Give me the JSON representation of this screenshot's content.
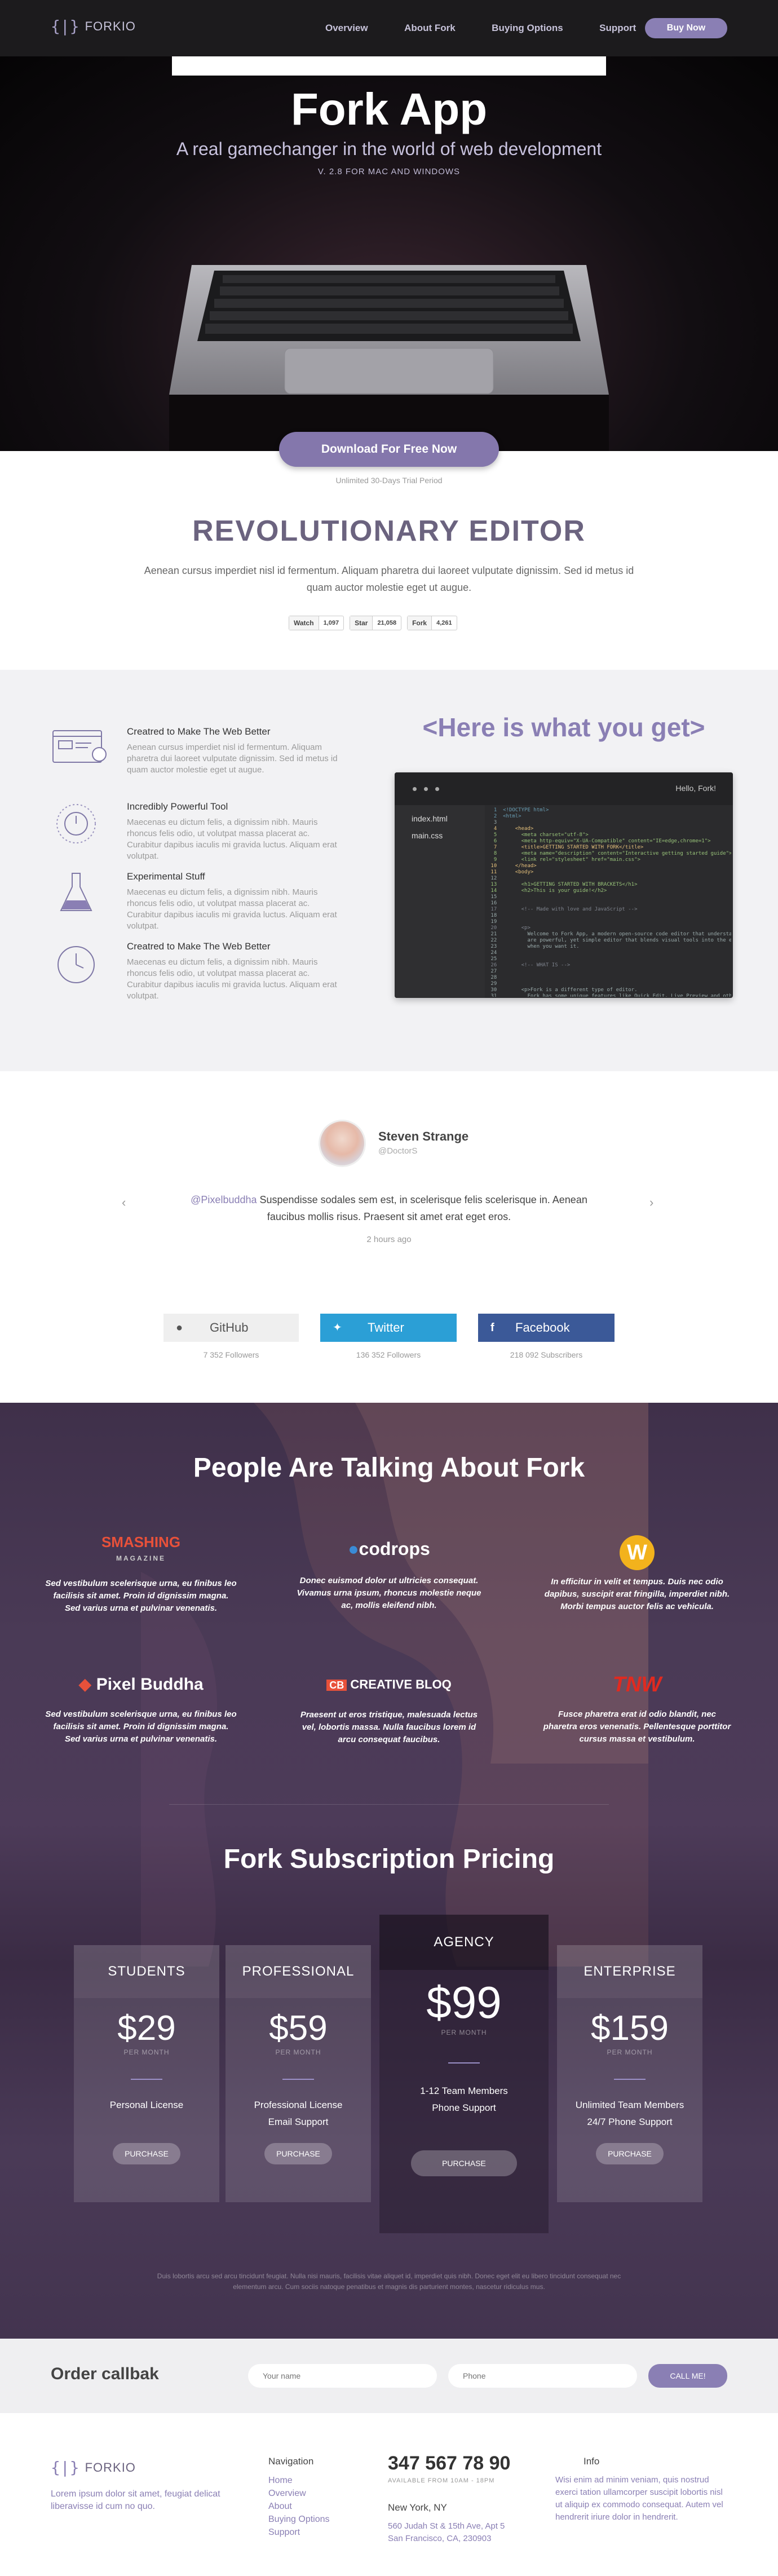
{
  "nav": {
    "logo_text": "FORKIO",
    "links": [
      "Overview",
      "About Fork",
      "Buying Options",
      "Support"
    ],
    "buy": "Buy Now"
  },
  "hero": {
    "title": "Fork App",
    "subtitle": "A real gamechanger in the world of web development",
    "version": "V. 2.8 FOR MAC AND WINDOWS"
  },
  "download": {
    "button": "Download For Free Now",
    "note": "Unlimited 30-Days Trial Period"
  },
  "editor": {
    "title": "REVOLUTIONARY EDITOR",
    "text": "Aenean cursus imperdiet nisl id fermentum. Aliquam pharetra dui laoreet vulputate dignissim. Sed id metus id quam auctor molestie eget ut augue.",
    "gh": [
      {
        "label": "Watch",
        "count": "1,097"
      },
      {
        "label": "Star",
        "count": "21,058"
      },
      {
        "label": "Fork",
        "count": "4,261"
      }
    ]
  },
  "features": {
    "heading": "<Here is what you get>",
    "items": [
      {
        "icon": "browser-magnifier-icon",
        "title": "Creatred to Make The Web Better",
        "text": "Aenean cursus imperdiet nisl id fermentum. Aliquam pharetra dui laoreet vulputate dignissim. Sed id metus id quam auctor molestie eget ut augue."
      },
      {
        "icon": "power-dial-icon",
        "title": "Incredibly Powerful Tool",
        "text": "Maecenas eu dictum felis, a dignissim nibh. Mauris rhoncus felis odio, ut volutpat massa placerat ac. Curabitur dapibus iaculis mi gravida luctus. Aliquam erat volutpat."
      },
      {
        "icon": "flask-icon",
        "title": "Experimental Stuff",
        "text": "Maecenas eu dictum felis, a dignissim nibh. Mauris rhoncus felis odio, ut volutpat massa placerat ac. Curabitur dapibus iaculis mi gravida luctus. Aliquam erat volutpat."
      },
      {
        "icon": "stopwatch-icon",
        "title": "Creatred to Make The Web Better",
        "text": "Maecenas eu dictum felis, a dignissim nibh. Mauris rhoncus felis odio, ut volutpat massa placerat ac. Curabitur dapibus iaculis mi gravida luctus. Aliquam erat volutpat."
      }
    ],
    "window": {
      "title": "Hello, Fork!",
      "files": [
        "index.html",
        "main.css"
      ]
    }
  },
  "testimonial": {
    "name": "Steven Strange",
    "handle": "@DoctorS",
    "mention": "@Pixelbuddha",
    "text": " Suspendisse sodales sem est, in scelerisque felis scelerisque in. Aenean faucibus mollis risus. Praesent sit amet erat eget eros.",
    "time": "2 hours ago"
  },
  "social": [
    {
      "name": "GitHub",
      "followers": "7 352 Followers",
      "color": "#efefef",
      "text": "#555"
    },
    {
      "name": "Twitter",
      "followers": "136 352 Followers",
      "color": "#2b9fd6",
      "text": "#fff"
    },
    {
      "name": "Facebook",
      "followers": "218 092 Subscribers",
      "color": "#3b5998",
      "text": "#fff"
    }
  ],
  "press": {
    "heading": "People Are Talking About Fork",
    "items": [
      {
        "logo": "SMASHING",
        "logo2": "MAGAZINE",
        "text": "Sed vestibulum scelerisque urna, eu finibus leo facilisis sit amet. Proin id dignissim magna. Sed varius urna et pulvinar venenatis."
      },
      {
        "logo": "codrops",
        "text": "Donec euismod dolor ut ultricies consequat. Vivamus urna ipsum, rhoncus molestie neque ac, mollis eleifend nibh."
      },
      {
        "logo": "W",
        "text": "In efficitur in velit et tempus. Duis nec odio dapibus, suscipit erat fringilla, imperdiet nibh. Morbi tempus auctor felis ac vehicula."
      },
      {
        "logo": "Pixel Buddha",
        "text": "Sed vestibulum scelerisque urna, eu finibus leo facilisis sit amet. Proin id dignissim magna. Sed varius urna et pulvinar venenatis."
      },
      {
        "logo": "CREATIVE BLOQ",
        "text": "Praesent ut eros tristique, malesuada lectus vel, lobortis massa. Nulla faucibus lorem id arcu consequat faucibus."
      },
      {
        "logo": "TNW",
        "text": "Fusce pharetra erat id odio blandit, nec pharetra eros venenatis. Pellentesque porttitor cursus massa et vestibulum."
      }
    ]
  },
  "pricing": {
    "heading": "Fork Subscription Pricing",
    "plans": [
      {
        "name": "STUDENTS",
        "price": "$29",
        "per": "PER MONTH",
        "features": [
          "Personal License"
        ],
        "cta": "PURCHASE"
      },
      {
        "name": "PROFESSIONAL",
        "price": "$59",
        "per": "PER MONTH",
        "features": [
          "Professional License",
          "Email Support"
        ],
        "cta": "PURCHASE"
      },
      {
        "name": "AGENCY",
        "price": "$99",
        "per": "PER MONTH",
        "features": [
          "1-12 Team Members",
          "Phone Support"
        ],
        "cta": "PURCHASE"
      },
      {
        "name": "ENTERPRISE",
        "price": "$159",
        "per": "PER MONTH",
        "features": [
          "Unlimited Team Members",
          "24/7 Phone Support"
        ],
        "cta": "PURCHASE"
      }
    ],
    "fineprint": "Duis lobortis arcu sed arcu tincidunt feugiat. Nulla nisi mauris, facilisis vitae aliquet id, imperdiet quis nibh. Donec eget elit eu libero tincidunt consequat nec elementum arcu. Cum sociis natoque penatibus et magnis dis parturient montes, nascetur ridiculus mus."
  },
  "callback": {
    "title": "Order callbak",
    "name_ph": "Your name",
    "phone_ph": "Phone",
    "button": "CALL ME!"
  },
  "footer": {
    "logo_text": "FORKIO",
    "about": "Lorem ipsum dolor sit amet, feugiat delicat liberavisse id cum no quo.",
    "nav_title": "Navigation",
    "nav": [
      "Home",
      "Overview",
      "About",
      "Buying Options",
      "Support"
    ],
    "phone": "347 567 78 90",
    "hours": "AVAILABLE FROM 10AM - 18PM",
    "city": "New York, NY",
    "address": "560 Judah St & 15th Ave, Apt 5 San Francisco, CA, 230903",
    "info_title": "Info",
    "info": "Wisi enim ad minim veniam, quis nostrud exerci tation ullamcorper suscipit lobortis nisl ut aliquip ex commodo consequat. Autem vel hendrerit iriure dolor in hendrerit."
  }
}
